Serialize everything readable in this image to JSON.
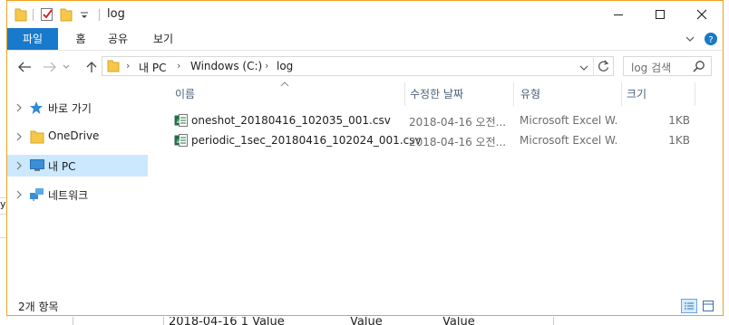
{
  "window": {
    "title": "log"
  },
  "ribbon": {
    "tabs": [
      "파일",
      "홈",
      "공유",
      "보기"
    ]
  },
  "address": {
    "crumbs": [
      "내 PC",
      "Windows (C:)",
      "log"
    ],
    "search_placeholder": "log 검색"
  },
  "nav": {
    "items": [
      {
        "label": "바로 가기",
        "icon": "star-pin-icon",
        "selected": false
      },
      {
        "label": "OneDrive",
        "icon": "folder-icon",
        "selected": false
      },
      {
        "label": "내 PC",
        "icon": "computer-icon",
        "selected": true
      },
      {
        "label": "네트워크",
        "icon": "network-icon",
        "selected": false
      }
    ]
  },
  "columns": {
    "name": "이름",
    "date": "수정한 날짜",
    "type": "유형",
    "size": "크기"
  },
  "files": [
    {
      "name": "oneshot_20180416_102035_001.csv",
      "date": "2018-04-16 오전...",
      "type": "Microsoft Excel W...",
      "size": "1KB"
    },
    {
      "name": "periodic_1sec_20180416_102024_001.csv",
      "date": "2018-04-16 오전...",
      "type": "Microsoft Excel W...",
      "size": "1KB"
    }
  ],
  "status": {
    "item_count": "2개 항목"
  },
  "background": {
    "left_char": "y",
    "bottom_texts": [
      "2018-04-16 1 Value",
      "Value",
      "Value"
    ]
  },
  "colors": {
    "accent": "#1979ca",
    "selection": "#cce8ff",
    "window_border": "#f0a020"
  }
}
